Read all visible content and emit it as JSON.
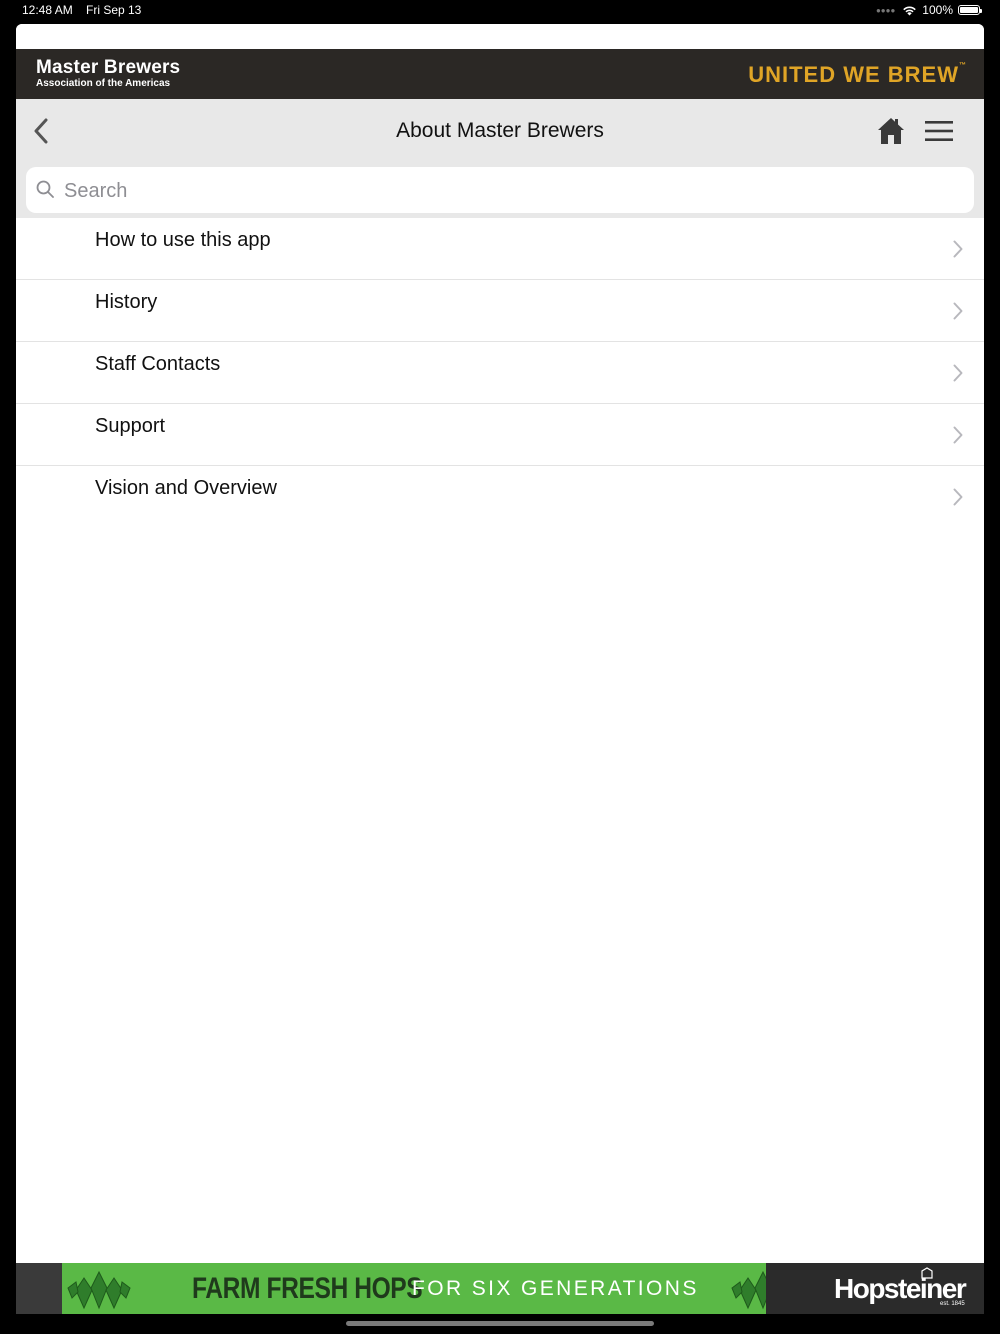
{
  "status_bar": {
    "time": "12:48 AM",
    "date": "Fri Sep 13",
    "battery": "100%",
    "battery_level": 1.0
  },
  "brand": {
    "name": "Master Brewers",
    "subtitle": "Association of the Americas",
    "tagline": "UNITED WE BREW",
    "tagline_mark": "™",
    "tagline_color": "#e0a526"
  },
  "nav": {
    "title": "About Master Brewers",
    "back_icon": "chevron-left-icon",
    "home_icon": "home-icon",
    "menu_icon": "hamburger-menu-icon"
  },
  "search": {
    "placeholder": "Search",
    "value": ""
  },
  "list": {
    "items": [
      {
        "label": "How to use this app"
      },
      {
        "label": "History"
      },
      {
        "label": "Staff Contacts"
      },
      {
        "label": "Support"
      },
      {
        "label": "Vision and Overview"
      }
    ]
  },
  "ad": {
    "headline": "FARM FRESH HOPS",
    "subline": "FOR SIX GENERATIONS",
    "brand": "Hopsteiner",
    "est": "est. 1845",
    "bg_color": "#5ab946"
  }
}
